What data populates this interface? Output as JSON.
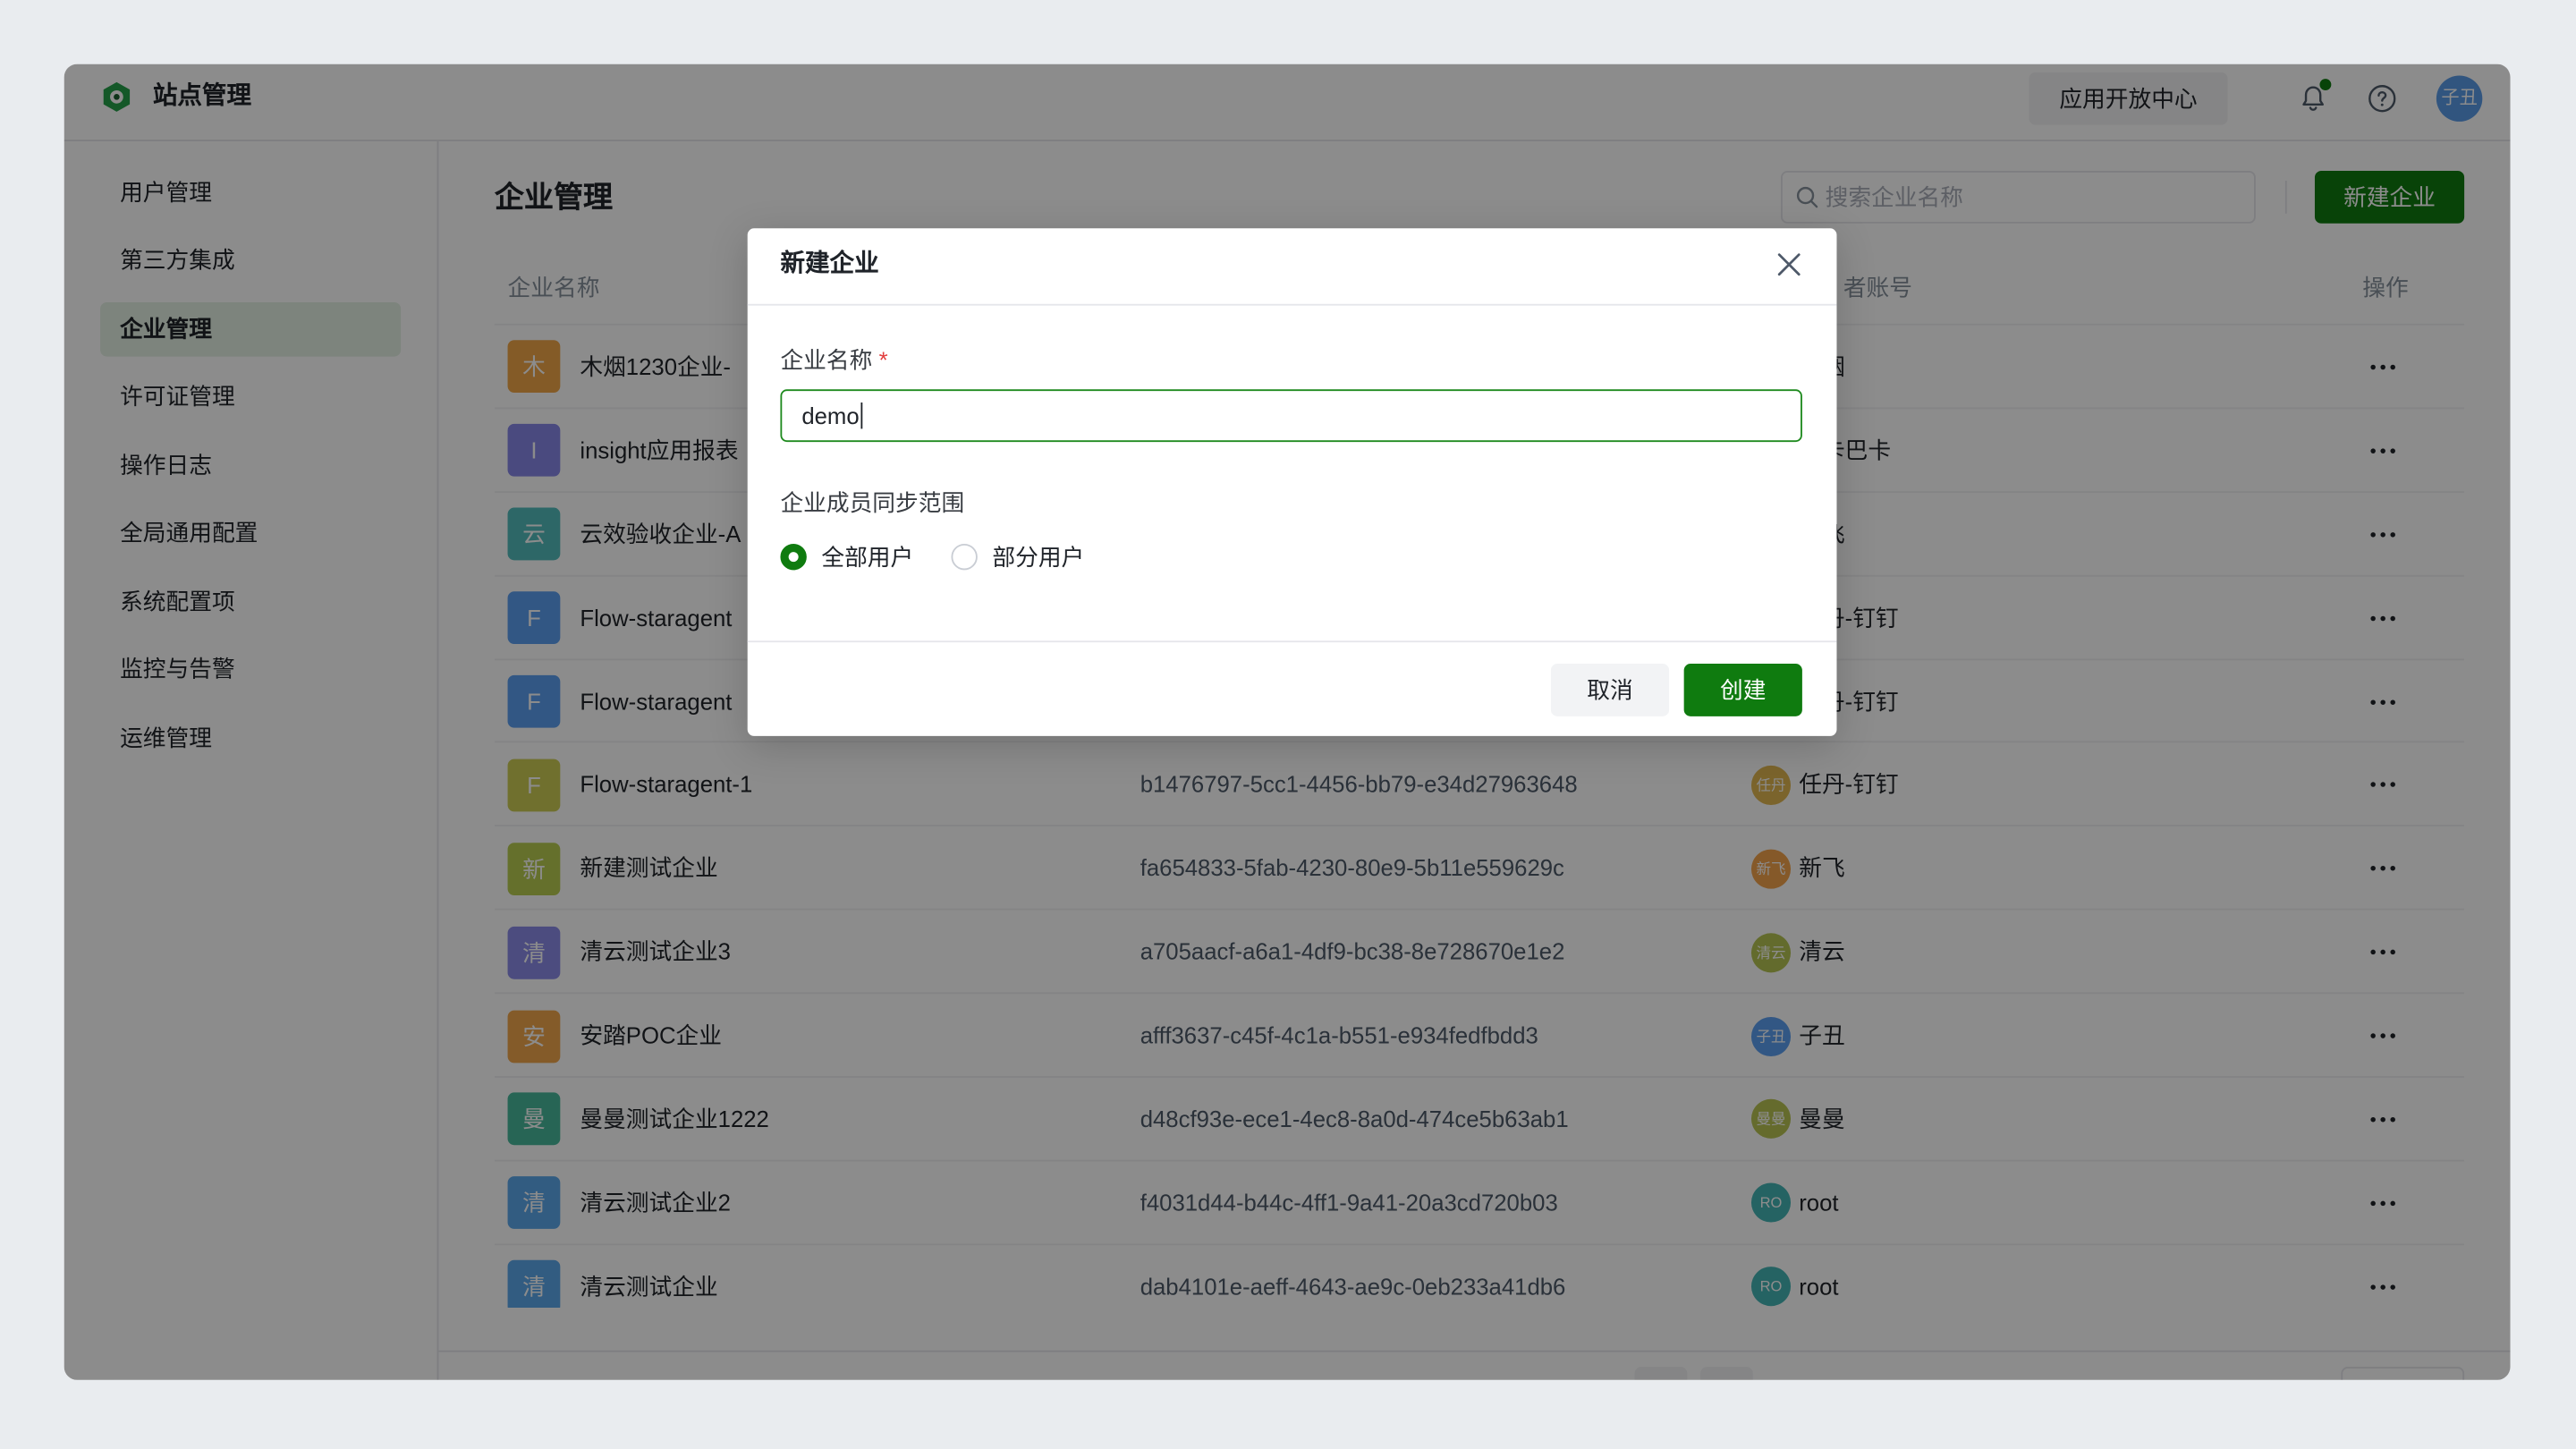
{
  "theme": {
    "brand": "#0f7b0f",
    "brand_light": "#e4f1e4",
    "danger": "#e33d3d",
    "avatar": "#5a9be8"
  },
  "app": {
    "title": "站点管理",
    "open_center_label": "应用开放中心",
    "avatar_text": "子丑",
    "icons": [
      "site-logo-icon",
      "bell-icon",
      "help-icon"
    ]
  },
  "sidebar": {
    "items": [
      {
        "label": "用户管理"
      },
      {
        "label": "第三方集成"
      },
      {
        "label": "企业管理"
      },
      {
        "label": "许可证管理"
      },
      {
        "label": "操作日志"
      },
      {
        "label": "全局通用配置"
      },
      {
        "label": "系统配置项"
      },
      {
        "label": "监控与告警"
      },
      {
        "label": "运维管理"
      }
    ],
    "active_index": 2
  },
  "main": {
    "title": "企业管理",
    "search_placeholder": "搜索企业名称",
    "search_icon": "search-icon",
    "new_button_label": "新建企业"
  },
  "table": {
    "columns": {
      "name": "企业名称",
      "account": "者账号",
      "actions": "操作"
    },
    "row_action_icon": "more-icon",
    "rows": [
      {
        "avatar": "木",
        "avatar_color": "#f0a648",
        "name": "木烟1230企业-",
        "account": "烟"
      },
      {
        "avatar": "I",
        "avatar_color": "#8888e8",
        "name": "insight应用报表",
        "account": "卡巴卡"
      },
      {
        "avatar": "云",
        "avatar_color": "#52bcbc",
        "name": "云效验收企业-A",
        "account": "飞"
      },
      {
        "avatar": "F",
        "avatar_color": "#5c9ff0",
        "name": "Flow-staragent",
        "account": "丹-钉钉"
      },
      {
        "avatar": "F",
        "avatar_color": "#5c9ff0",
        "name": "Flow-staragent",
        "account": "丹-钉钉"
      },
      {
        "avatar": "F",
        "avatar_color": "#cccc55",
        "name": "Flow-staragent-1",
        "id": "b1476797-5cc1-4456-bb79-e34d27963648",
        "account_avatar": "任丹",
        "account_avatar_color": "#e0b650",
        "account": "任丹-钉钉"
      },
      {
        "avatar": "新",
        "avatar_color": "#b8cc50",
        "name": "新建测试企业",
        "id": "fa654833-5fab-4230-80e9-5b11e559629c",
        "account_avatar": "新飞",
        "account_avatar_color": "#f2a24c",
        "account": "新飞"
      },
      {
        "avatar": "清",
        "avatar_color": "#8a8ae8",
        "name": "清云测试企业3",
        "id": "a705aacf-a6a1-4df9-bc38-8e728670e1e2",
        "account_avatar": "清云",
        "account_avatar_color": "#b4c452",
        "account": "清云"
      },
      {
        "avatar": "安",
        "avatar_color": "#f0a64c",
        "name": "安踏POC企业",
        "id": "afff3637-c45f-4c1a-b551-e934fedfbdd3",
        "account_avatar": "子丑",
        "account_avatar_color": "#5c9ff0",
        "account": "子丑"
      },
      {
        "avatar": "曼",
        "avatar_color": "#48b89c",
        "name": "曼曼测试企业1222",
        "id": "d48cf93e-ece1-4ec8-8a0d-474ce5b63ab1",
        "account_avatar": "曼曼",
        "account_avatar_color": "#b8c452",
        "account": "曼曼"
      },
      {
        "avatar": "清",
        "avatar_color": "#5ca8ec",
        "name": "清云测试企业2",
        "id": "f4031d44-b44c-4ff1-9a41-20a3cd720b03",
        "account_avatar": "RO",
        "account_avatar_color": "#44b4b4",
        "account": "root"
      },
      {
        "avatar": "清",
        "avatar_color": "#5ca8ec",
        "name": "清云测试企业",
        "id": "dab4101e-aeff-4643-ae9c-0eb233a41db6",
        "account_avatar": "RO",
        "account_avatar_color": "#44b4b4",
        "account": "root"
      }
    ]
  },
  "modal": {
    "title": "新建企业",
    "close_icon": "close-icon",
    "name_label": "企业名称",
    "required_mark": "*",
    "name_value": "demo",
    "scope_label": "企业成员同步范围",
    "scope_options": [
      {
        "label": "全部用户",
        "checked": true
      },
      {
        "label": "部分用户",
        "checked": false
      }
    ],
    "cancel_label": "取消",
    "create_label": "创建"
  }
}
